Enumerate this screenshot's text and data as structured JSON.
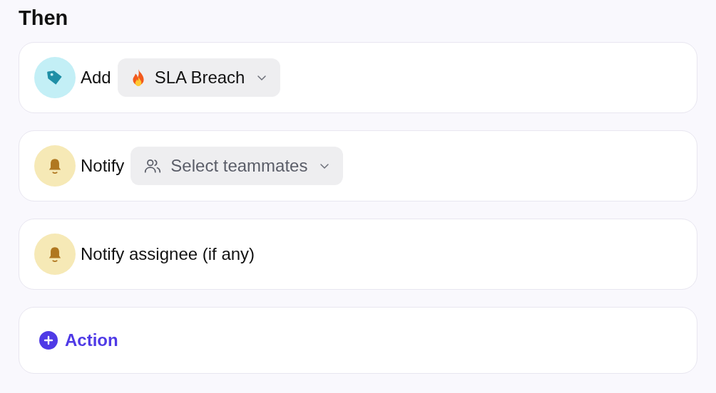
{
  "heading": "Then",
  "actions": [
    {
      "kind": "tag",
      "label": "Add",
      "dropdown": {
        "value": "SLA Breach"
      }
    },
    {
      "kind": "notify",
      "label": "Notify",
      "dropdown": {
        "placeholder": "Select teammates"
      }
    },
    {
      "kind": "notify",
      "label": "Notify assignee (if any)"
    }
  ],
  "add_button": {
    "label": "Action"
  }
}
